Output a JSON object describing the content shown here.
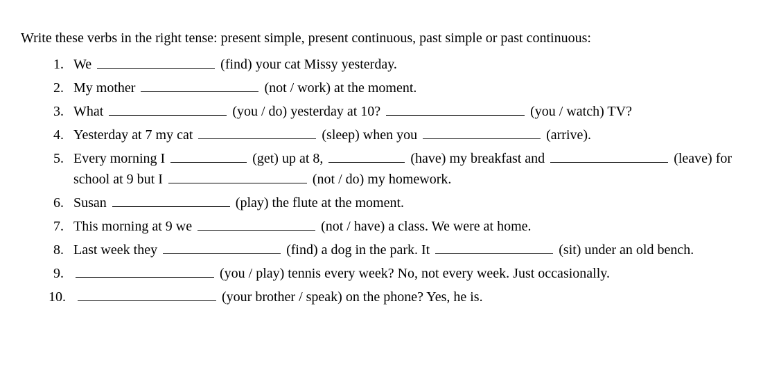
{
  "instructions": "Write these verbs in the right tense: present simple, present continuous, past simple or past continuous:",
  "items": [
    {
      "num": "1.",
      "parts": [
        "We ",
        "_med",
        " (find) your cat Missy yesterday."
      ]
    },
    {
      "num": "2.",
      "parts": [
        "My mother ",
        "_med",
        " (not / work) at the moment."
      ]
    },
    {
      "num": "3.",
      "parts": [
        "What ",
        "_med",
        " (you / do) yesterday at 10? ",
        "_long",
        " (you / watch) TV?"
      ]
    },
    {
      "num": "4.",
      "parts": [
        "Yesterday at 7 my cat ",
        "_med",
        " (sleep) when you ",
        "_med",
        " (arrive)."
      ]
    },
    {
      "num": "5.",
      "parts": [
        "Every morning I ",
        "_short",
        " (get) up at 8, ",
        "_short",
        " (have) my breakfast and ",
        "_med",
        " (leave) for school at 9 but I ",
        "_long",
        " (not / do) my homework."
      ]
    },
    {
      "num": "6.",
      "parts": [
        "Susan ",
        "_med",
        " (play) the flute at the moment."
      ]
    },
    {
      "num": "7.",
      "parts": [
        "This morning at 9 we ",
        "_med",
        " (not / have) a class. We were at home."
      ]
    },
    {
      "num": "8.",
      "parts": [
        "Last week they ",
        "_med",
        " (find) a dog in the park. It ",
        "_med",
        " (sit) under an old bench."
      ]
    },
    {
      "num": "9.",
      "parts": [
        "_long",
        " (you / play) tennis every week? No, not every week. Just occasionally."
      ]
    },
    {
      "num": "10.",
      "parts": [
        "_long",
        " (your brother / speak) on the phone? Yes, he is."
      ]
    }
  ]
}
